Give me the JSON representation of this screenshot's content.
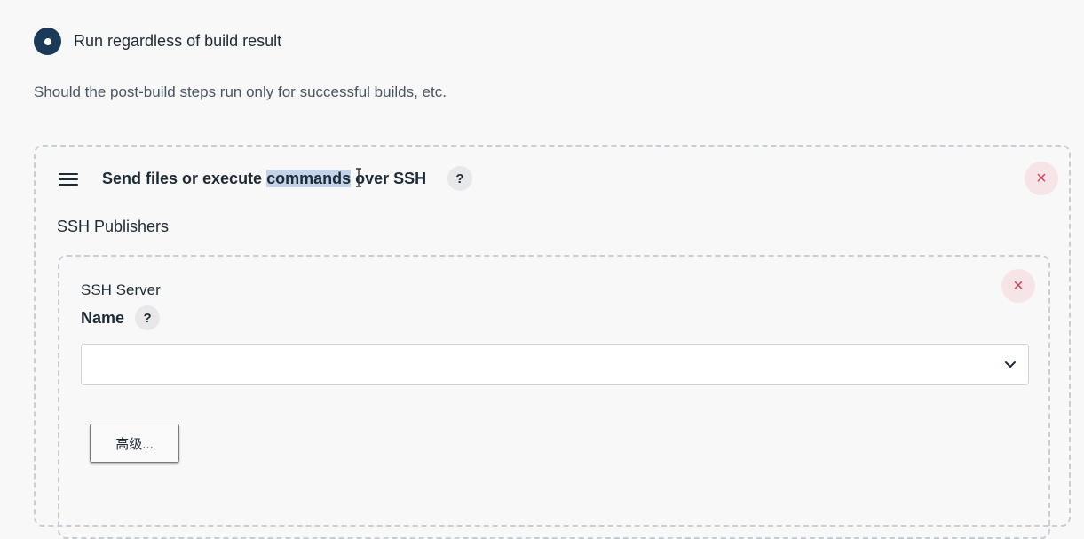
{
  "run_option": {
    "label": "Run regardless of build result",
    "selected": true
  },
  "description": "Should the post-build steps run only for successful builds, etc.",
  "step": {
    "title_prefix": "Send files or execute ",
    "title_selected": "commands",
    "title_suffix": " over SSH",
    "help_label": "?",
    "close_icon": "×",
    "drag_icon": "hamburger-icon"
  },
  "publishers": {
    "section_label": "SSH Publishers",
    "server": {
      "label": "SSH Server",
      "name_label": "Name",
      "name_help": "?",
      "name_value": "",
      "close_icon": "×",
      "advanced_button": "高级..."
    }
  },
  "colors": {
    "radio": "#1b3a5a",
    "close": "#d0424f",
    "selection": "#c2d3ea"
  }
}
